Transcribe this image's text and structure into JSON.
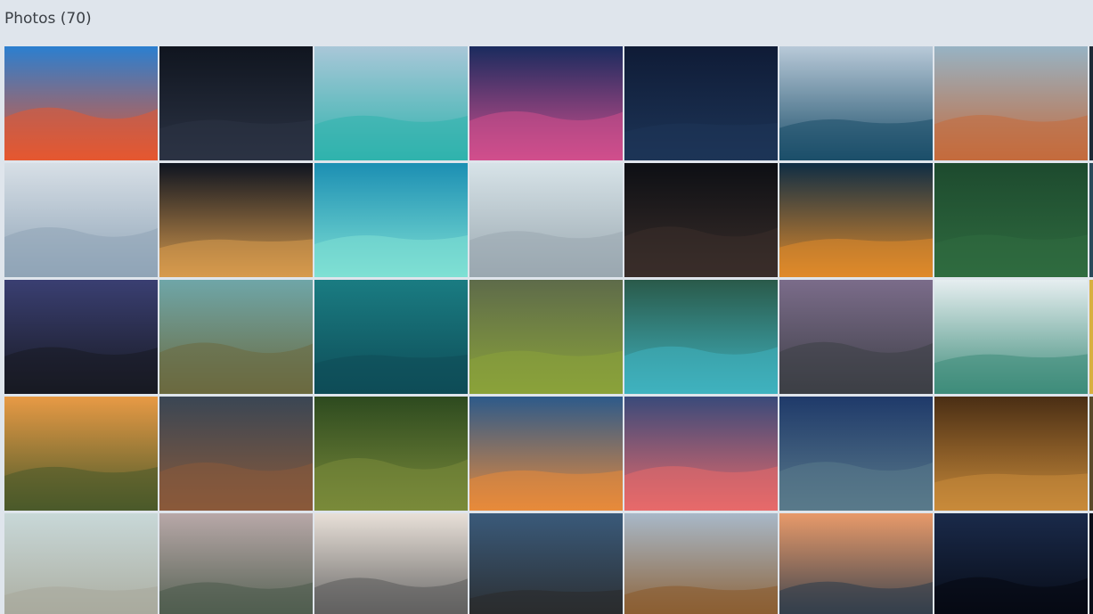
{
  "header": {
    "title": "Photos (70)"
  },
  "photos": [
    {
      "name": "photo-color-explosion",
      "bg": [
        "#2b7fd0",
        "#e6572f"
      ]
    },
    {
      "name": "photo-woman-sparkler-swirl",
      "bg": [
        "#10151f",
        "#2b3344"
      ]
    },
    {
      "name": "photo-mountain-lake-hiker",
      "bg": [
        "#a9c7d8",
        "#2fb3ad"
      ]
    },
    {
      "name": "photo-purple-sunset-rocks",
      "bg": [
        "#1a2b5e",
        "#d14f8d"
      ]
    },
    {
      "name": "photo-lake-lighthouse-night",
      "bg": [
        "#0f1b36",
        "#1d3557"
      ]
    },
    {
      "name": "photo-sea-cave-arch",
      "bg": [
        "#b8c9d8",
        "#1c4f6a"
      ]
    },
    {
      "name": "photo-snowy-mountains-sunset",
      "bg": [
        "#97b3c4",
        "#c46b3d"
      ]
    },
    {
      "name": "photo-matterhorn-climber",
      "bg": [
        "#d7dfe6",
        "#8fa4b7"
      ]
    },
    {
      "name": "photo-man-sky-lantern",
      "bg": [
        "#0e1420",
        "#d79a4d"
      ]
    },
    {
      "name": "photo-tropical-island-aerial",
      "bg": [
        "#1c8fb3",
        "#7fe0d4"
      ]
    },
    {
      "name": "photo-woman-sparkler-snow",
      "bg": [
        "#d7e3e8",
        "#9aa8b0"
      ]
    },
    {
      "name": "photo-girl-fairy-lights",
      "bg": [
        "#0d0f14",
        "#3a2e2a"
      ]
    },
    {
      "name": "photo-milky-way-sky",
      "bg": [
        "#0f2d44",
        "#e08a2a"
      ]
    },
    {
      "name": "photo-plane-forest-aerial",
      "bg": [
        "#1d4a2e",
        "#2f6b3f"
      ]
    },
    {
      "name": "photo-coastal-city-night",
      "bg": [
        "#3a3f72",
        "#181a22"
      ]
    },
    {
      "name": "photo-land-rover-coast",
      "bg": [
        "#6fa6a8",
        "#6b6a3f"
      ]
    },
    {
      "name": "photo-penguin-underwater",
      "bg": [
        "#1a7c82",
        "#0e4c57"
      ]
    },
    {
      "name": "photo-mossy-rocks-aerial",
      "bg": [
        "#5e6b4a",
        "#8aa23a"
      ]
    },
    {
      "name": "photo-beach-aerial",
      "bg": [
        "#2a5a4a",
        "#3fb2bf"
      ]
    },
    {
      "name": "photo-glacier-valley",
      "bg": [
        "#7b6c8a",
        "#3d3f46"
      ]
    },
    {
      "name": "photo-clouds-over-sea",
      "bg": [
        "#e6eef0",
        "#3e8c7a"
      ]
    },
    {
      "name": "photo-winding-road-sunset",
      "bg": [
        "#e89a45",
        "#4a5a2a"
      ]
    },
    {
      "name": "photo-dramatic-mountain-sky",
      "bg": [
        "#3a4654",
        "#8a5a3a"
      ]
    },
    {
      "name": "photo-forest-bridge-aerial",
      "bg": [
        "#2d4a1f",
        "#7a8a3a"
      ]
    },
    {
      "name": "photo-man-silhouette-city",
      "bg": [
        "#2d5a8a",
        "#e88a3a"
      ]
    },
    {
      "name": "photo-pink-sky-mountain",
      "bg": [
        "#3a4a7a",
        "#e86a6a"
      ]
    },
    {
      "name": "photo-rocky-mountain-river",
      "bg": [
        "#1f3a6a",
        "#5a7a8a"
      ]
    },
    {
      "name": "photo-museum-hall",
      "bg": [
        "#4a2e14",
        "#c88a3a"
      ]
    },
    {
      "name": "photo-feet-on-pier",
      "bg": [
        "#c8d8d8",
        "#a8a89a"
      ]
    },
    {
      "name": "photo-yosemite-couple",
      "bg": [
        "#b8a8a8",
        "#4a5a4a"
      ]
    },
    {
      "name": "photo-private-jet-runway",
      "bg": [
        "#e8e0d8",
        "#5a5a5a"
      ]
    },
    {
      "name": "photo-plane-wreck-person",
      "bg": [
        "#3a5a7a",
        "#2a2a2a"
      ]
    },
    {
      "name": "photo-suspension-bridge-autumn",
      "bg": [
        "#a8b8c8",
        "#8a5a2a"
      ]
    },
    {
      "name": "photo-mountain-peaks-dawn",
      "bg": [
        "#e89a6a",
        "#2a3a4a"
      ]
    },
    {
      "name": "photo-tree-under-stars",
      "bg": [
        "#1a2a4a",
        "#050810"
      ]
    }
  ]
}
